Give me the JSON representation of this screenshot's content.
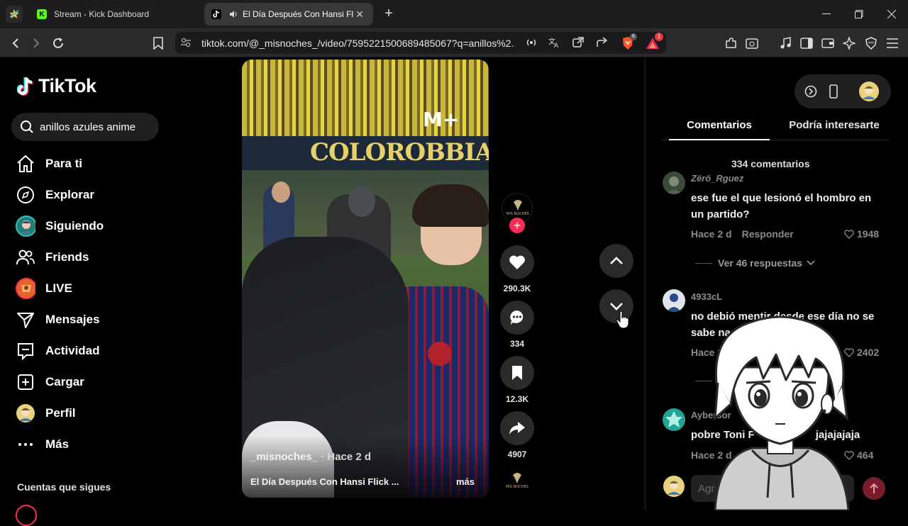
{
  "browser": {
    "tabs": [
      {
        "title": "Stream - Kick Dashboard",
        "active": false
      },
      {
        "title": "El Día Después Con Hansi Flick",
        "active": true
      }
    ],
    "url": "tiktok.com/@_misnoches_/video/7595221500689485067?q=anillos%2...",
    "shield_badge": "6",
    "alert_badge": "1"
  },
  "sidebar": {
    "logo": "TikTok",
    "search_value": "anillos azules anime",
    "items": [
      {
        "label": "Para ti",
        "icon": "home-icon"
      },
      {
        "label": "Explorar",
        "icon": "compass-icon"
      },
      {
        "label": "Siguiendo",
        "icon": "following-avatar"
      },
      {
        "label": "Friends",
        "icon": "friends-icon"
      },
      {
        "label": "LIVE",
        "icon": "live-avatar"
      },
      {
        "label": "Mensajes",
        "icon": "paper-plane-icon"
      },
      {
        "label": "Actividad",
        "icon": "activity-icon"
      },
      {
        "label": "Cargar",
        "icon": "upload-icon"
      },
      {
        "label": "Perfil",
        "icon": "profile-avatar"
      },
      {
        "label": "Más",
        "icon": "more-dots-icon"
      }
    ],
    "following_header": "Cuentas que sigues"
  },
  "video": {
    "banner": "COLOROBBIA",
    "author": "_misnoches_",
    "posted": "· Hace 2 d",
    "caption": "El Día Después Con Hansi Flick ...",
    "more": "más"
  },
  "actions": {
    "likes": "290.3K",
    "comments": "334",
    "saves": "12.3K",
    "shares": "4907"
  },
  "panel": {
    "tab_comments": "Comentarios",
    "tab_interest": "Podría interesarte",
    "comment_count": "334 comentarios",
    "comments": [
      {
        "user": "Zërö_Rguez",
        "text": "ese fue el que lesionó el hombro en un partido?",
        "time": "Hace 2 d",
        "reply": "Responder",
        "likes": "1948"
      },
      {
        "user": "4933cL",
        "text": "no debió mentir desde ese día no se sabe nad",
        "time": "Hace 2",
        "reply": "",
        "likes": "2402"
      },
      {
        "user": "Aybersor",
        "text": "pobre Toni F",
        "text2": "jajajajaja",
        "time": "Hace 2 d",
        "reply": "R",
        "likes": "464"
      }
    ],
    "view_replies": "Ver 46 respuestas",
    "add_comment": "Agr"
  }
}
